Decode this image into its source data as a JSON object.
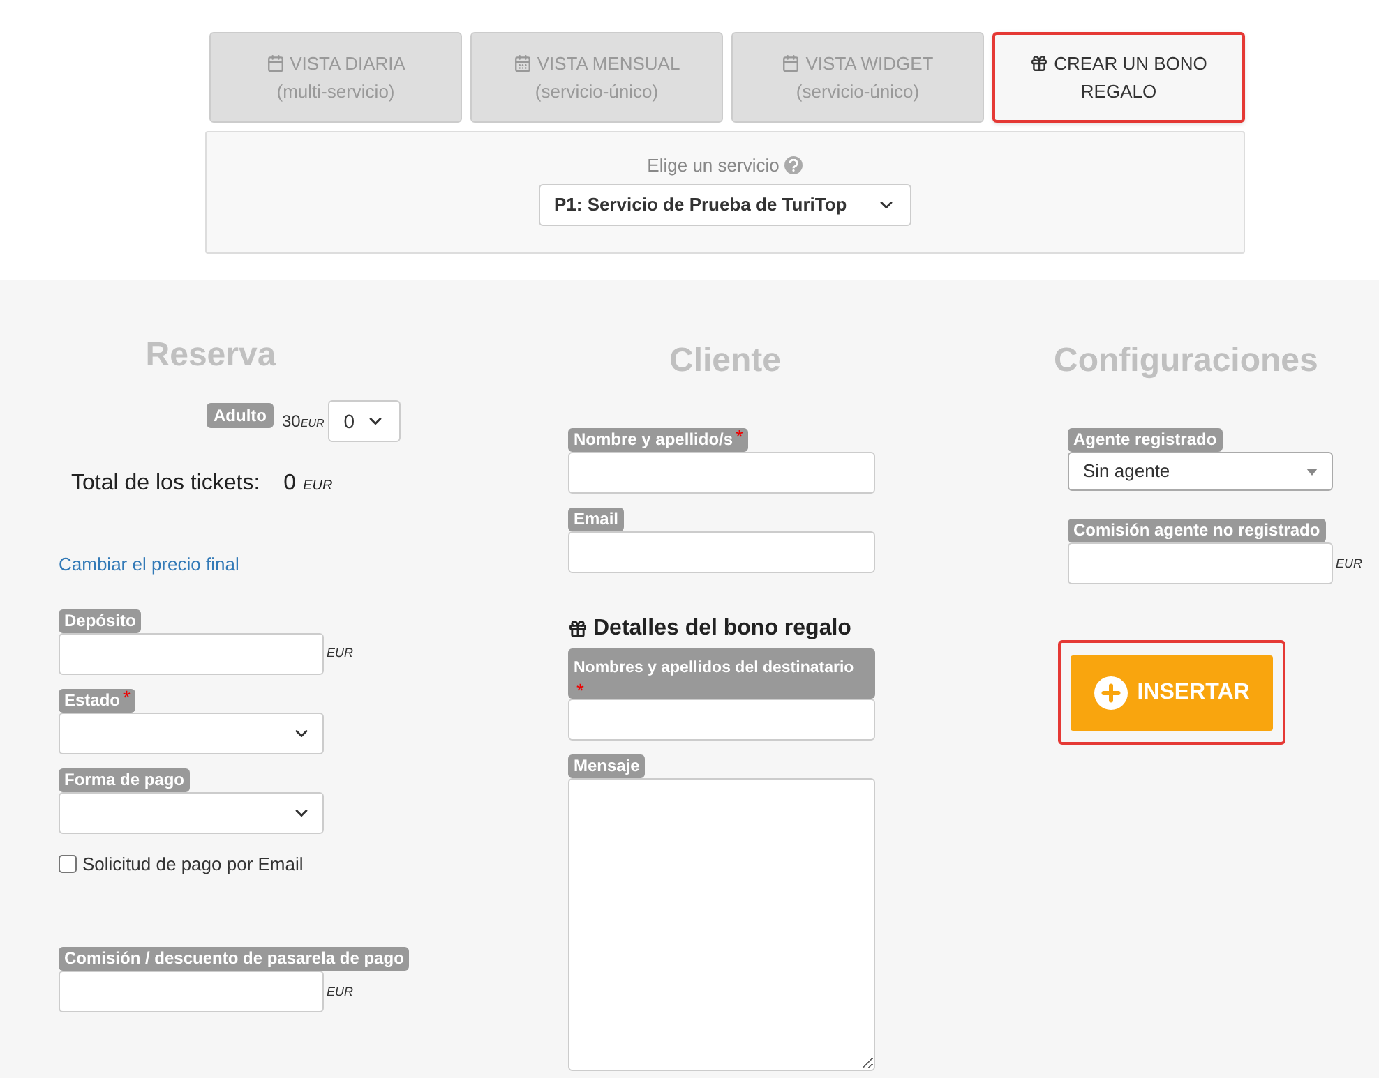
{
  "tabs": [
    {
      "kind": "calendar",
      "title": "VISTA DIARIA",
      "subtitle": "(multi-servicio)",
      "selected": false
    },
    {
      "kind": "calendar-grid",
      "title": "VISTA MENSUAL",
      "subtitle": "(servicio-único)",
      "selected": false
    },
    {
      "kind": "calendar",
      "title": "VISTA WIDGET",
      "subtitle": "(servicio-único)",
      "selected": false
    },
    {
      "kind": "gift",
      "title": "CREAR UN BONO REGALO",
      "selected": true
    }
  ],
  "service": {
    "label": "Elige un servicio",
    "value": "P1: Servicio de Prueba de TuriTop"
  },
  "reserva": {
    "heading": "Reserva",
    "tickets": [
      {
        "label": "Adulto",
        "price": "30",
        "currency": "EUR",
        "quantity": "0"
      }
    ],
    "total": {
      "label": "Total de los tickets:",
      "value": "0",
      "currency": "EUR"
    },
    "link": "Cambiar el precio final",
    "fields": [
      {
        "kind": "input",
        "label": "Depósito",
        "unit": "EUR"
      },
      {
        "kind": "select",
        "label": "Estado",
        "required_mark": "*"
      },
      {
        "kind": "select",
        "label": "Forma de pago"
      },
      {
        "kind": "checkbox",
        "label": "Solicitud de pago por Email",
        "checked": false
      },
      {
        "kind": "input",
        "label": "Comisión / descuento de pasarela de pago",
        "unit": "EUR"
      }
    ]
  },
  "cliente": {
    "heading": "Cliente",
    "fields": [
      {
        "kind": "input",
        "label": "Nombre y apellido/s",
        "required_mark": "*"
      },
      {
        "kind": "input",
        "label": "Email"
      }
    ],
    "gift_heading": "Detalles del bono regalo",
    "gift_fields": [
      {
        "kind": "input",
        "label": "Nombres y apellidos del destinatario",
        "required_mark": "*"
      },
      {
        "kind": "textarea",
        "label": "Mensaje"
      }
    ]
  },
  "configuraciones": {
    "heading": "Configuraciones",
    "fields": [
      {
        "kind": "dropdown",
        "label": "Agente registrado",
        "value": "Sin agente"
      },
      {
        "kind": "input",
        "label": "Comisión agente no registrado",
        "unit": "EUR"
      }
    ],
    "button": "INSERTAR"
  }
}
